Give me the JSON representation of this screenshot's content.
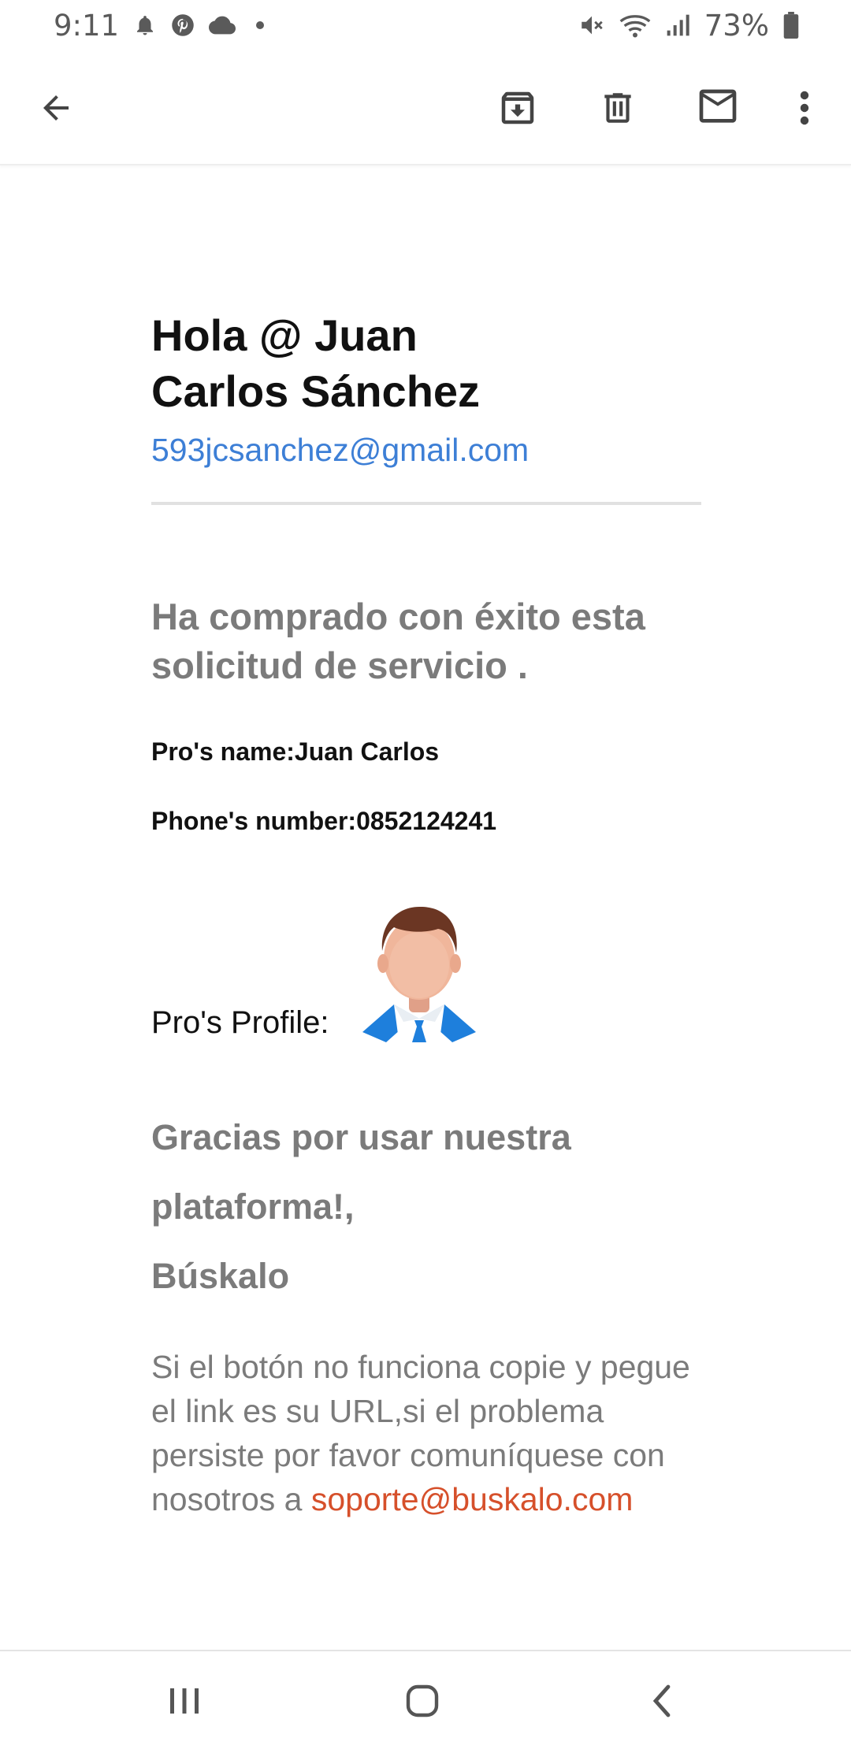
{
  "status_bar": {
    "time": "9:11",
    "battery_percent": "73%",
    "left_icons": [
      "bell-icon",
      "pinterest-icon",
      "cloud-icon",
      "dot-icon"
    ],
    "right_icons": [
      "mute-icon",
      "wifi-icon",
      "signal-icon",
      "battery-icon"
    ]
  },
  "toolbar": {
    "icons": [
      "back-arrow-icon",
      "archive-icon",
      "trash-icon",
      "mail-icon",
      "more-vert-icon"
    ]
  },
  "email": {
    "greeting_line1": "Hola @ Juan",
    "greeting_line2": "Carlos Sánchez",
    "recipient_email": "593jcsanchez@gmail.com",
    "success_message": "Ha comprado con éxito esta solicitud de servicio .",
    "pro_name": "Pro's name:Juan Carlos",
    "phone_number": "Phone's number:0852124241",
    "profile_label": "Pro's Profile:",
    "thanks_line1": "Gracias por usar nuestra",
    "thanks_line2": "plataforma!,",
    "signature": "Búskalo",
    "note_text": "Si el botón no funciona copie y pegue el link es su URL,si el problema persiste por favor comuníquese con nosotros a",
    "support_email": "soporte@buskalo.com"
  },
  "colors": {
    "link_blue": "#3d7fd6",
    "support_orange": "#d6502b",
    "gray_text": "#7b7b7b",
    "avatar_blue": "#1e7fdc"
  },
  "nav_bar": {
    "icons": [
      "recent-apps-icon",
      "home-icon",
      "back-icon"
    ]
  }
}
